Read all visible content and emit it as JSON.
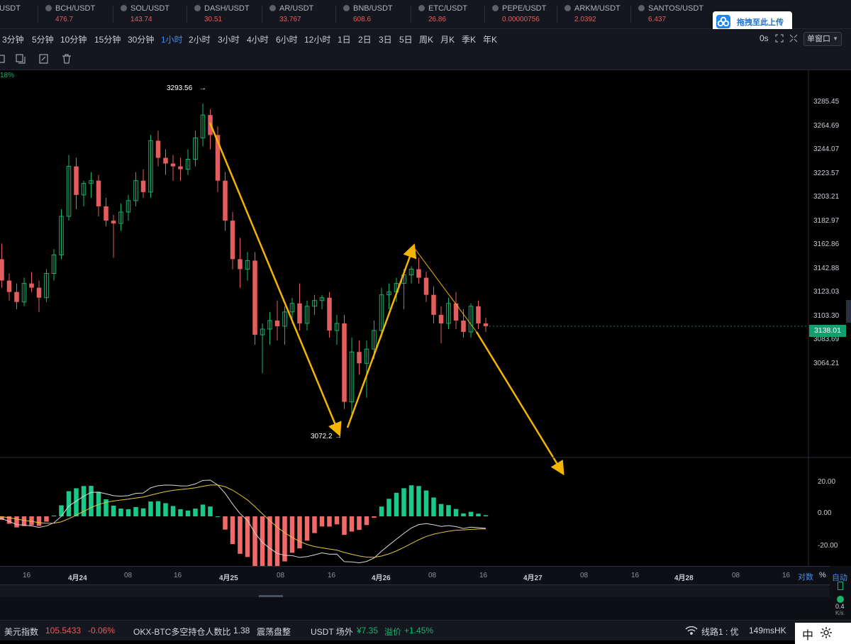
{
  "ticker": [
    {
      "symbol": "USDT",
      "price": ""
    },
    {
      "symbol": "BCH/USDT",
      "price": "476.7"
    },
    {
      "symbol": "SOL/USDT",
      "price": "143.74"
    },
    {
      "symbol": "DASH/USDT",
      "price": "30.51"
    },
    {
      "symbol": "AR/USDT",
      "price": "33.767"
    },
    {
      "symbol": "BNB/USDT",
      "price": "608.6"
    },
    {
      "symbol": "ETC/USDT",
      "price": "26.86"
    },
    {
      "symbol": "PEPE/USDT",
      "price": "0.00000756"
    },
    {
      "symbol": "ARKM/USDT",
      "price": "2.0392"
    },
    {
      "symbol": "SANTOS/USDT",
      "price": "6.437"
    }
  ],
  "upload_button": "拖拽至此上传",
  "intervals": [
    "3分钟",
    "5分钟",
    "10分钟",
    "15分钟",
    "30分钟",
    "1小时",
    "2小时",
    "3小时",
    "4小时",
    "6小时",
    "12小时",
    "1日",
    "2日",
    "3日",
    "5日",
    "周K",
    "月K",
    "季K",
    "年K"
  ],
  "active_interval": "1小时",
  "countdown": "0s",
  "window_mode": "单窗口",
  "pct_label": "18%",
  "price_axis": [
    "3285.45",
    "3264.69",
    "3244.07",
    "3223.57",
    "3203.21",
    "3182.97",
    "3162.86",
    "3142.88",
    "3123.03",
    "3103.30",
    "3083.69",
    "3064.21"
  ],
  "current_price": "3138.01",
  "high_label": "3293.56",
  "low_label": "3072.2",
  "macd_axis": [
    "20.00",
    "0.00",
    "-20.00"
  ],
  "x_axis": [
    "16",
    "4月24",
    "08",
    "16",
    "4月25",
    "08",
    "16",
    "4月26",
    "08",
    "16",
    "4月27",
    "08",
    "16",
    "4月28",
    "08",
    "16"
  ],
  "x_bold": [
    "4月24",
    "4月25",
    "4月26",
    "4月27",
    "4月28"
  ],
  "axis_mode": {
    "log": "对数",
    "pct": "%",
    "auto": "自动"
  },
  "speed": {
    "value": "0.4",
    "unit": "K/s"
  },
  "status": {
    "dxy_label": "美元指数",
    "dxy_value": "105.5433",
    "dxy_change": "-0.06%",
    "ratio_label": "OKX-BTC多空持仓人数比",
    "ratio_value": "1.38",
    "ratio_state": "震荡盘整",
    "otc_label": "USDT 场外",
    "otc_price": "¥7.35",
    "premium_label": "溢价",
    "premium_value": "+1.45%",
    "line_label": "线路1 : 优",
    "latency": "149ms",
    "region": "HK"
  },
  "lang": "中",
  "colors": {
    "up": "#19b36b",
    "down": "#e25d5d",
    "arrow": "#f5b400",
    "accent": "#3d8df5"
  },
  "chart_data": {
    "type": "candlestick",
    "interval": "1小时",
    "y_range": [
      3055,
      3298
    ],
    "candles": [
      [
        3181,
        3193,
        3178,
        3185
      ],
      [
        3185,
        3196,
        3165,
        3170
      ],
      [
        3170,
        3175,
        3156,
        3162
      ],
      [
        3162,
        3168,
        3150,
        3155
      ],
      [
        3155,
        3172,
        3152,
        3168
      ],
      [
        3168,
        3176,
        3162,
        3165
      ],
      [
        3165,
        3170,
        3148,
        3158
      ],
      [
        3158,
        3178,
        3155,
        3175
      ],
      [
        3175,
        3192,
        3170,
        3188
      ],
      [
        3188,
        3220,
        3185,
        3215
      ],
      [
        3215,
        3258,
        3212,
        3250
      ],
      [
        3250,
        3256,
        3220,
        3230
      ],
      [
        3230,
        3240,
        3222,
        3238
      ],
      [
        3238,
        3246,
        3228,
        3240
      ],
      [
        3240,
        3244,
        3215,
        3222
      ],
      [
        3222,
        3228,
        3208,
        3212
      ],
      [
        3212,
        3216,
        3186,
        3210
      ],
      [
        3210,
        3224,
        3205,
        3218
      ],
      [
        3218,
        3230,
        3212,
        3226
      ],
      [
        3226,
        3246,
        3222,
        3240
      ],
      [
        3240,
        3248,
        3228,
        3232
      ],
      [
        3232,
        3272,
        3228,
        3268
      ],
      [
        3268,
        3275,
        3250,
        3256
      ],
      [
        3256,
        3262,
        3244,
        3252
      ],
      [
        3252,
        3258,
        3240,
        3250
      ],
      [
        3250,
        3256,
        3240,
        3248
      ],
      [
        3248,
        3262,
        3244,
        3255
      ],
      [
        3255,
        3275,
        3250,
        3270
      ],
      [
        3270,
        3294,
        3264,
        3286
      ],
      [
        3286,
        3290,
        3262,
        3272
      ],
      [
        3272,
        3278,
        3232,
        3240
      ],
      [
        3240,
        3246,
        3205,
        3212
      ],
      [
        3212,
        3218,
        3178,
        3185
      ],
      [
        3185,
        3200,
        3165,
        3178
      ],
      [
        3178,
        3190,
        3170,
        3184
      ],
      [
        3184,
        3190,
        3125,
        3132
      ],
      [
        3132,
        3140,
        3105,
        3136
      ],
      [
        3136,
        3148,
        3125,
        3142
      ],
      [
        3142,
        3156,
        3128,
        3138
      ],
      [
        3138,
        3152,
        3125,
        3148
      ],
      [
        3148,
        3158,
        3140,
        3154
      ],
      [
        3154,
        3168,
        3135,
        3140
      ],
      [
        3140,
        3156,
        3135,
        3152
      ],
      [
        3152,
        3160,
        3146,
        3156
      ],
      [
        3156,
        3160,
        3150,
        3158
      ],
      [
        3158,
        3162,
        3130,
        3135
      ],
      [
        3135,
        3146,
        3125,
        3140
      ],
      [
        3140,
        3146,
        3080,
        3085
      ],
      [
        3085,
        3130,
        3076,
        3120
      ],
      [
        3120,
        3128,
        3104,
        3112
      ],
      [
        3112,
        3128,
        3088,
        3122
      ],
      [
        3122,
        3142,
        3115,
        3135
      ],
      [
        3135,
        3165,
        3130,
        3160
      ],
      [
        3160,
        3168,
        3150,
        3162
      ],
      [
        3162,
        3172,
        3155,
        3168
      ],
      [
        3168,
        3178,
        3150,
        3174
      ],
      [
        3174,
        3180,
        3168,
        3178
      ],
      [
        3178,
        3186,
        3168,
        3172
      ],
      [
        3172,
        3176,
        3155,
        3160
      ],
      [
        3160,
        3166,
        3140,
        3146
      ],
      [
        3146,
        3152,
        3126,
        3140
      ],
      [
        3140,
        3158,
        3136,
        3154
      ],
      [
        3154,
        3162,
        3136,
        3142
      ],
      [
        3142,
        3150,
        3130,
        3134
      ],
      [
        3134,
        3154,
        3130,
        3152
      ],
      [
        3152,
        3156,
        3136,
        3140
      ],
      [
        3140,
        3144,
        3134,
        3138
      ]
    ],
    "annotations": [
      {
        "type": "max",
        "label": "3293.56"
      },
      {
        "type": "min",
        "label": "3072.2"
      }
    ],
    "indicator": {
      "name": "MACD",
      "y_range": [
        -27,
        27
      ]
    }
  }
}
